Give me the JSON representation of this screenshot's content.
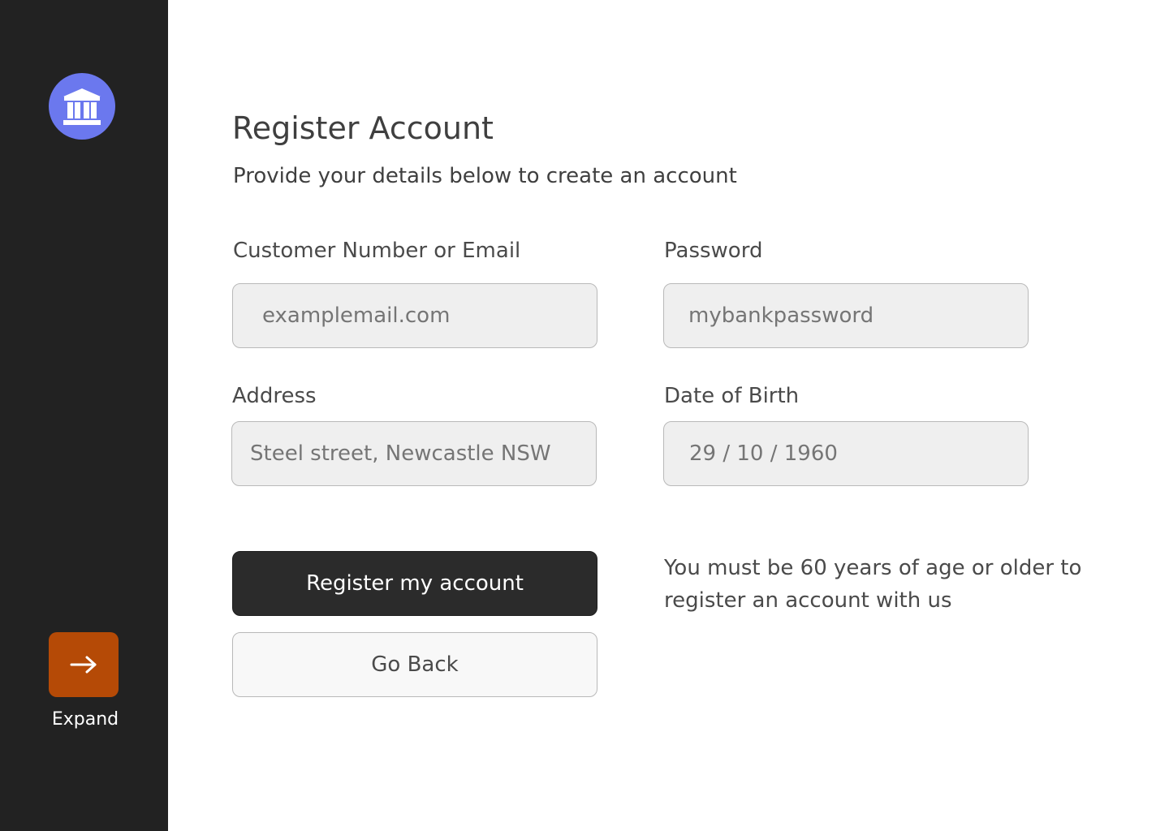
{
  "sidebar": {
    "logo_icon": "bank-icon",
    "expand_icon": "arrow-right-icon",
    "expand_label": "Expand",
    "colors": {
      "background": "#222222",
      "logo": "#6b78ee",
      "expand_button": "#b54a06"
    }
  },
  "main": {
    "title": "Register Account",
    "subtitle": "Provide your details below to create an account",
    "fields": {
      "email": {
        "label": "Customer Number or Email",
        "placeholder": "examplemail.com"
      },
      "password": {
        "label": "Password",
        "placeholder": "mybankpassword"
      },
      "address": {
        "label": "Address",
        "placeholder": "Steel street, Newcastle NSW"
      },
      "dob": {
        "label": "Date of Birth",
        "placeholder": "29 / 10 / 1960"
      }
    },
    "register_label": "Register my account",
    "back_label": "Go Back",
    "age_note": "You must be 60 years of age or older to register an account with us"
  }
}
